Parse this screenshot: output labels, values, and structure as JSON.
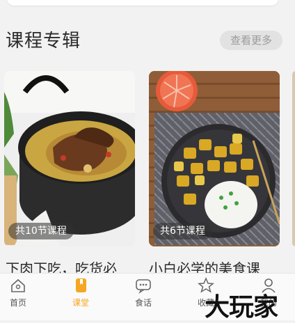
{
  "section": {
    "title": "课程专辑",
    "more_label": "查看更多"
  },
  "cards": [
    {
      "badge": "共10节课程",
      "title": "下肉下吃，吃货必"
    },
    {
      "badge": "共6节课程",
      "title": "小白必学的美食课"
    }
  ],
  "tabbar": {
    "tabs": [
      {
        "label": "首页",
        "icon": "home-icon",
        "active": false
      },
      {
        "label": "课堂",
        "icon": "classroom-icon",
        "active": true
      },
      {
        "label": "食话",
        "icon": "chat-icon",
        "active": false
      },
      {
        "label": "收藏",
        "icon": "star-icon",
        "active": false
      },
      {
        "label": "我的",
        "icon": "user-icon",
        "active": false
      }
    ],
    "active_color": "#f5a623"
  },
  "watermark": {
    "text": "大玩家"
  }
}
